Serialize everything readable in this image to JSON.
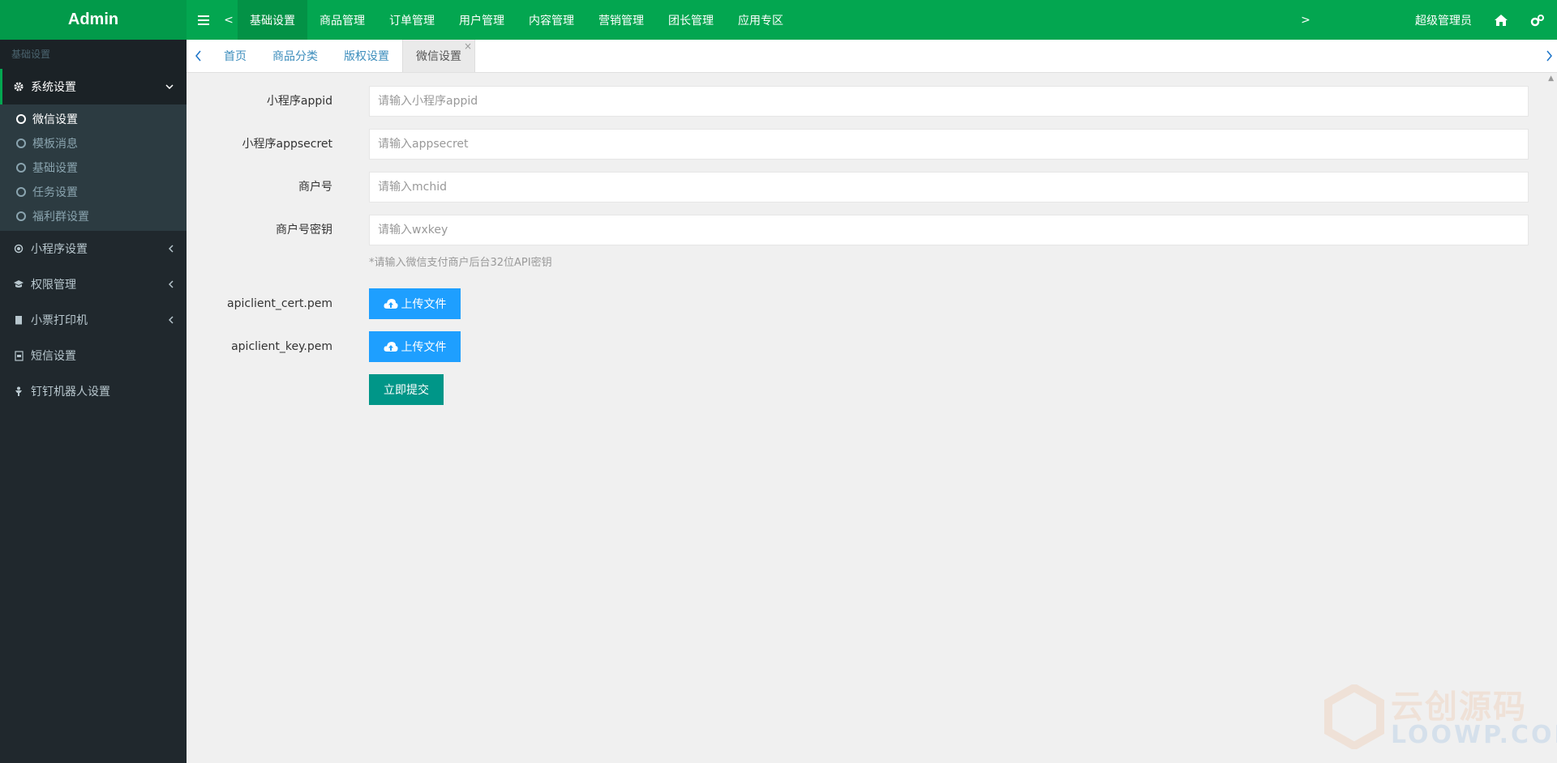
{
  "app": {
    "title": "Admin",
    "brand_color": "#03a650"
  },
  "topnav": {
    "prev": "<",
    "next": ">",
    "items": [
      {
        "label": "基础设置",
        "active": true
      },
      {
        "label": "商品管理"
      },
      {
        "label": "订单管理"
      },
      {
        "label": "用户管理"
      },
      {
        "label": "内容管理"
      },
      {
        "label": "营销管理"
      },
      {
        "label": "团长管理"
      },
      {
        "label": "应用专区"
      }
    ],
    "user": "超级管理员",
    "icons": [
      "bars-icon",
      "home-icon",
      "cogs-icon"
    ]
  },
  "sidebar": {
    "header": "基础设置",
    "items": [
      {
        "label": "系统设置",
        "icon": "gear-icon",
        "open": true,
        "children": [
          {
            "label": "微信设置",
            "active": true
          },
          {
            "label": "模板消息"
          },
          {
            "label": "基础设置"
          },
          {
            "label": "任务设置"
          },
          {
            "label": "福利群设置"
          }
        ]
      },
      {
        "label": "小程序设置",
        "icon": "dot-circle-icon"
      },
      {
        "label": "权限管理",
        "icon": "graduation-cap-icon"
      },
      {
        "label": "小票打印机",
        "icon": "book-icon"
      },
      {
        "label": "短信设置",
        "icon": "sms-file-icon"
      },
      {
        "label": "钉钉机器人设置",
        "icon": "robot-icon"
      }
    ]
  },
  "tabs": {
    "items": [
      {
        "label": "首页"
      },
      {
        "label": "商品分类"
      },
      {
        "label": "版权设置"
      },
      {
        "label": "微信设置",
        "active": true
      }
    ],
    "close": "×"
  },
  "form": {
    "appid": {
      "label": "小程序appid",
      "placeholder": "请输入小程序appid",
      "value": ""
    },
    "appsecret": {
      "label": "小程序appsecret",
      "placeholder": "请输入appsecret",
      "value": ""
    },
    "mchid": {
      "label": "商户号",
      "placeholder": "请输入mchid",
      "value": ""
    },
    "wxkey": {
      "label": "商户号密钥",
      "placeholder": "请输入wxkey",
      "value": ""
    },
    "wxkey_hint": "*请输入微信支付商户后台32位API密钥",
    "cert": {
      "label": "apiclient_cert.pem",
      "button": "上传文件"
    },
    "key": {
      "label": "apiclient_key.pem",
      "button": "上传文件"
    },
    "submit": "立即提交"
  },
  "colors": {
    "upload": "#1e9fff",
    "submit": "#009688",
    "sidebar_bg": "#20282d"
  }
}
